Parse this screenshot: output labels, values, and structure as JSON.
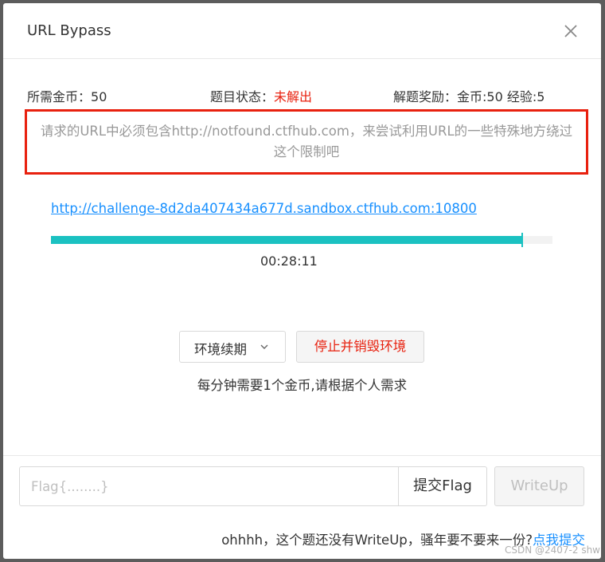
{
  "dialog": {
    "title": "URL Bypass",
    "close_icon": "close-icon"
  },
  "info": {
    "coins_label": "所需金币：",
    "coins_value": "50",
    "status_label": "题目状态：",
    "status_value": "未解出",
    "status_color": "#e8210f",
    "reward_label": "解题奖励：",
    "reward_value": "金币:50 经验:5"
  },
  "notice": {
    "line1": "请求的URL中必须包含http://notfound.ctfhub.com，来尝试利用URL的一些特殊地方绕过",
    "line2": "这个限制吧"
  },
  "environment": {
    "url": "http://challenge-8d2da407434a677d.sandbox.ctfhub.com:10800",
    "progress_fraction": 0.94,
    "timer": "00:28:11",
    "renew_label": "环境续期",
    "renew_icon": "chevron-down-icon",
    "stop_label": "停止并销毁环境",
    "cost_note": "每分钟需要1个金币,请根据个人需求"
  },
  "footer": {
    "flag_placeholder": "Flag{........}",
    "submit_label": "提交Flag",
    "writeup_label": "WriteUp",
    "note_text": "ohhhh，这个题还没有WriteUp，骚年要不要来一份?",
    "note_link": "点我提交"
  },
  "watermark": "CSDN @2407-2 shw",
  "colors": {
    "accent": "#1890ff",
    "danger": "#e8210f",
    "progress": "#1bc1c1"
  }
}
